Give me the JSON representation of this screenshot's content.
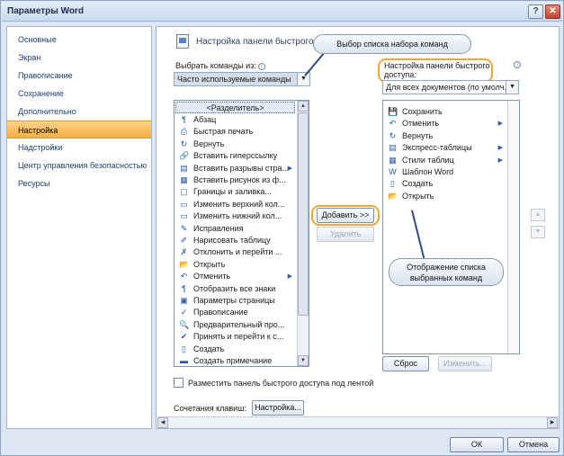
{
  "window": {
    "title": "Параметры Word"
  },
  "titlebar_buttons": {
    "help": "?",
    "close": "✕"
  },
  "nav": {
    "items": [
      {
        "label": "Основные",
        "active": false
      },
      {
        "label": "Экран",
        "active": false
      },
      {
        "label": "Правописание",
        "active": false
      },
      {
        "label": "Сохранение",
        "active": false
      },
      {
        "label": "Дополнительно",
        "active": false
      },
      {
        "label": "Настройка",
        "active": true
      },
      {
        "label": "Надстройки",
        "active": false
      },
      {
        "label": "Центр управления безопасностью",
        "active": false
      },
      {
        "label": "Ресурсы",
        "active": false
      }
    ]
  },
  "content": {
    "title": "Настройка панели быстрого",
    "choose_label": "Выбрать команды из:",
    "choose_value": "Часто используемые команды",
    "qat_label_line1": "Настройка панели быстрого",
    "qat_label_line2": "доступа:",
    "qat_value": "Для всех документов (по умолч...",
    "info_symbol": "i",
    "separator_item": "<Разделитель>",
    "commands": [
      {
        "icon": "¶",
        "label": "Абзац",
        "submenu": false
      },
      {
        "icon": "⎙",
        "label": "Быстрая печать",
        "submenu": false
      },
      {
        "icon": "↻",
        "label": "Вернуть",
        "submenu": false
      },
      {
        "icon": "🔗",
        "label": "Вставить гиперссылку",
        "submenu": false
      },
      {
        "icon": "▤",
        "label": "Вставить разрывы стра...",
        "submenu": true
      },
      {
        "icon": "▦",
        "label": "Вставить рисунок из ф...",
        "submenu": false
      },
      {
        "icon": "▢",
        "label": "Границы и заливка...",
        "submenu": false
      },
      {
        "icon": "▭",
        "label": "Изменить верхний кол...",
        "submenu": false
      },
      {
        "icon": "▭",
        "label": "Изменить нижний кол...",
        "submenu": false
      },
      {
        "icon": "✎",
        "label": "Исправления",
        "submenu": false
      },
      {
        "icon": "✐",
        "label": "Нарисовать таблицу",
        "submenu": false
      },
      {
        "icon": "✗",
        "label": "Отклонить и перейти ...",
        "submenu": false
      },
      {
        "icon": "📂",
        "label": "Открыть",
        "submenu": false
      },
      {
        "icon": "↶",
        "label": "Отменить",
        "submenu": true
      },
      {
        "icon": "¶",
        "label": "Отобразить все знаки",
        "submenu": false
      },
      {
        "icon": "▣",
        "label": "Параметры страницы",
        "submenu": false
      },
      {
        "icon": "✓",
        "label": "Правописание",
        "submenu": false
      },
      {
        "icon": "🔍",
        "label": "Предварительный про...",
        "submenu": false
      },
      {
        "icon": "✔",
        "label": "Принять и перейти к с...",
        "submenu": false
      },
      {
        "icon": "▯",
        "label": "Создать",
        "submenu": false
      },
      {
        "icon": "▬",
        "label": "Создать примечание",
        "submenu": false
      }
    ],
    "add_button": "Добавить >>",
    "remove_button": "Удалить",
    "selected": [
      {
        "icon": "💾",
        "label": "Сохранить",
        "submenu": false
      },
      {
        "icon": "↶",
        "label": "Отменить",
        "submenu": true
      },
      {
        "icon": "↻",
        "label": "Вернуть",
        "submenu": false
      },
      {
        "icon": "▤",
        "label": "Экспресс-таблицы",
        "submenu": true
      },
      {
        "icon": "▦",
        "label": "Стили таблиц",
        "submenu": true
      },
      {
        "icon": "W",
        "label": "Шаблон Word",
        "submenu": false
      },
      {
        "icon": "▯",
        "label": "Создать",
        "submenu": false
      },
      {
        "icon": "📂",
        "label": "Открыть",
        "submenu": false
      }
    ],
    "move_up": "▲",
    "move_down": "▼",
    "reset_button": "Сброс",
    "modify_button": "Изменить...",
    "below_ribbon_label": "Разместить панель быстрого доступа под лентой",
    "shortcuts_label": "Сочетания клавиш:",
    "shortcuts_button": "Настройка..."
  },
  "callouts": {
    "top": "Выбор списка набора команд",
    "bottom_line1": "Отображение списка",
    "bottom_line2": "выбранных команд"
  },
  "footer": {
    "ok": "ОК",
    "cancel": "Отмена"
  }
}
